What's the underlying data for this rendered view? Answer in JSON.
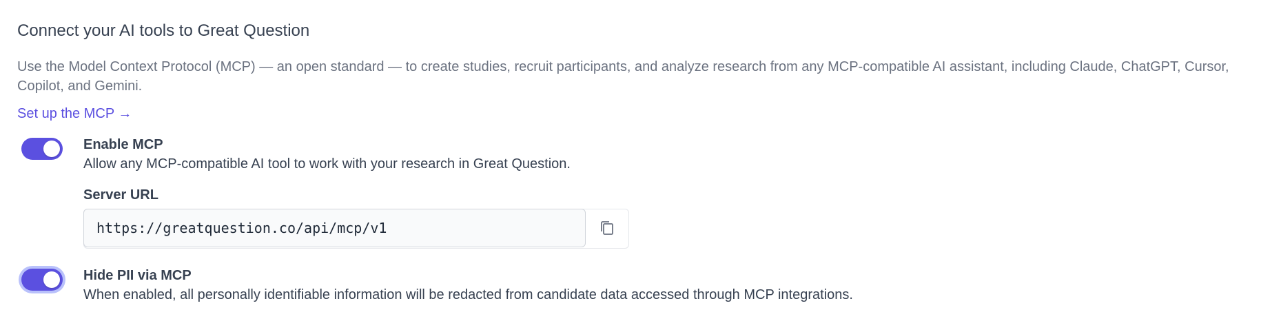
{
  "section": {
    "heading": "Connect your AI tools to Great Question",
    "description": "Use the Model Context Protocol (MCP) — an open standard — to create studies, recruit participants, and analyze research from any MCP-compatible AI assistant, including Claude, ChatGPT, Cursor, Copilot, and Gemini.",
    "setup_link": "Set up the MCP →"
  },
  "enable_mcp": {
    "enabled": true,
    "title": "Enable MCP",
    "description": "Allow any MCP-compatible AI tool to work with your research in Great Question."
  },
  "server_url": {
    "label": "Server URL",
    "value": "https://greatquestion.co/api/mcp/v1",
    "copy_icon": "copy-icon"
  },
  "hide_pii": {
    "enabled": true,
    "title": "Hide PII via MCP",
    "description": "When enabled, all personally identifiable information will be redacted from candidate data accessed through MCP integrations."
  },
  "colors": {
    "accent": "#5b50e0",
    "link": "#5b4fe0",
    "focus_ring": "#b9c1fb"
  }
}
